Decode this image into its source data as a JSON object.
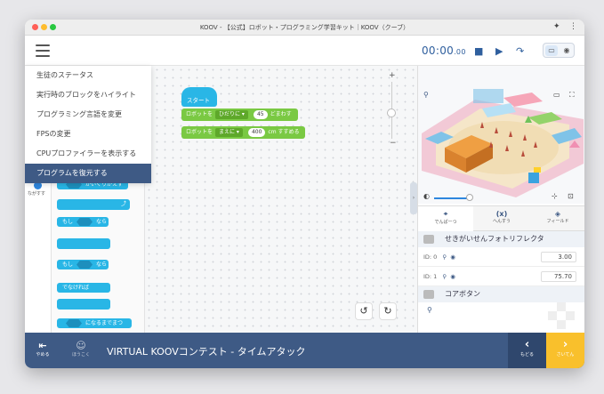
{
  "window": {
    "title": "KOOV - 【公式】ロボット・プログラミング学習キット｜KOOV（クーブ）"
  },
  "timer": {
    "main": "00:00",
    "fraction": ".00"
  },
  "menu": {
    "items": [
      {
        "label": "生徒のステータス"
      },
      {
        "label": "実行時のブロックをハイライト"
      },
      {
        "label": "プログラミング言語を変更"
      },
      {
        "label": "FPSの変更"
      },
      {
        "label": "CPUプロファイラーを表示する"
      },
      {
        "label": "プログラムを復元する"
      }
    ],
    "selected_index": 5
  },
  "palette": {
    "category_label": "ながすす",
    "blocks": [
      {
        "text": "かいくりかえす"
      },
      {
        "text": "もし",
        "suffix": "なら"
      },
      {
        "text": "もし",
        "suffix": "なら"
      },
      {
        "text": "でなければ"
      },
      {
        "text": "になるまでまつ"
      }
    ]
  },
  "program": {
    "start_label": "スタート",
    "blocks": [
      {
        "prefix": "ロボットを",
        "select": "ひだりに ▾",
        "value": "45",
        "suffix": "どまわす"
      },
      {
        "prefix": "ロボットを",
        "select": "まえに ▾",
        "value": "400",
        "suffix": "cm すすめる"
      }
    ]
  },
  "zoom": {
    "plus": "+",
    "minus": "−",
    "level": 0.45
  },
  "sim_tabs": [
    {
      "icon": "⌖",
      "label": "でんぱーつ"
    },
    {
      "icon": "(x)",
      "label": "へんすう"
    },
    {
      "icon": "◈",
      "label": "フィールド"
    }
  ],
  "sensors": [
    {
      "name": "せきがいせんフォトリフレクタ",
      "rows": [
        {
          "id": "ID: 0",
          "value": "3.00"
        },
        {
          "id": "ID: 1",
          "value": "75.70"
        }
      ]
    },
    {
      "name": "コアボタン",
      "rows": []
    }
  ],
  "bottom": {
    "quit_label": "やめる",
    "report_label": "ほうこく",
    "title": "VIRTUAL KOOVコンテスト - タイムアタック",
    "back_label": "もどる",
    "next_label": "さいてん"
  },
  "colors": {
    "accent": "#3e5a85",
    "control_block": "#29b6e6",
    "motion_block": "#7ac943",
    "next": "#f9c02c"
  }
}
